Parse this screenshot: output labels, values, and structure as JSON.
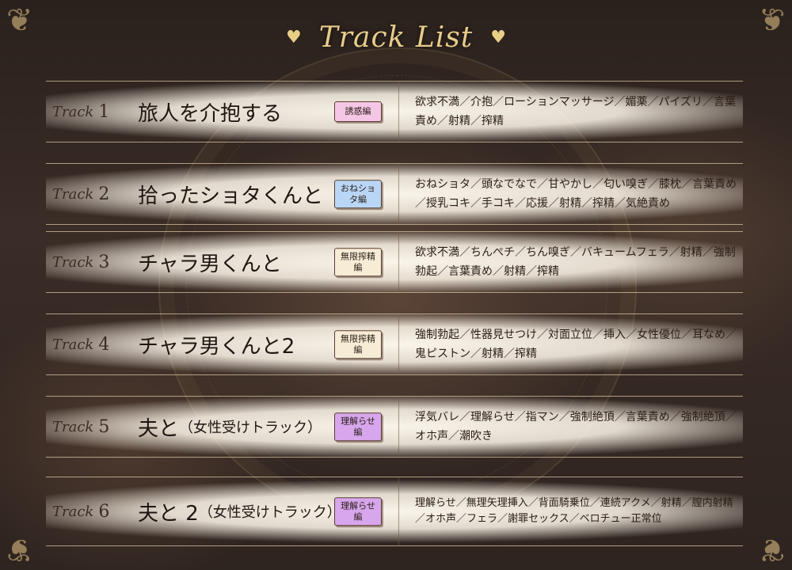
{
  "header": {
    "title": "Track List",
    "heart_left": "♥",
    "heart_right": "♥"
  },
  "colors": {
    "gold": "#e7cc8a",
    "badge_pink": "#f6c6e6",
    "badge_blue": "#b9d6f6",
    "badge_cream": "#f7ecd6",
    "badge_purple": "#d7a6ec"
  },
  "tracks": [
    {
      "word": "Track",
      "num": "1",
      "title": "旅人を介抱する",
      "title_sub": "",
      "badge": "誘惑編",
      "tags": "欲求不満／介抱／ローションマッサージ／媚薬／パイズリ／言葉責め／射精／搾精"
    },
    {
      "word": "Track",
      "num": "2",
      "title": "拾ったショタくんと",
      "title_sub": "",
      "badge": "おねショタ編",
      "tags": "おねショタ／頭なでなで／甘やかし／匂い嗅ぎ／膝枕／言葉責め／授乳コキ／手コキ／応援／射精／搾精／気絶責め"
    },
    {
      "word": "Track",
      "num": "3",
      "title": "チャラ男くんと",
      "title_sub": "",
      "badge": "無限搾精編",
      "tags": "欲求不満／ちんぺチ／ちん嗅ぎ／バキュームフェラ／射精／強制勃起／言葉責め／射精／搾精"
    },
    {
      "word": "Track",
      "num": "4",
      "title": "チャラ男くんと2",
      "title_sub": "",
      "badge": "無限搾精編",
      "tags": "強制勃起／性器見せつけ／対面立位／挿入／女性優位／耳なめ／鬼ピストン／射精／搾精"
    },
    {
      "word": "Track",
      "num": "5",
      "title": "夫と",
      "title_sub": "（女性受けトラック）",
      "badge": "理解らせ編",
      "tags": "浮気バレ／理解らせ／指マン／強制絶頂／言葉責め／強制絶頂／オホ声／潮吹き"
    },
    {
      "word": "Track",
      "num": "6",
      "title": "夫と 2",
      "title_sub": "（女性受けトラック）",
      "badge": "理解らせ編",
      "tags": "理解らせ／無理矢理挿入／背面騎乗位／連続アクメ／射精／膣内射精／オホ声／フェラ／謝罪セックス／ベロチュー正常位"
    }
  ]
}
